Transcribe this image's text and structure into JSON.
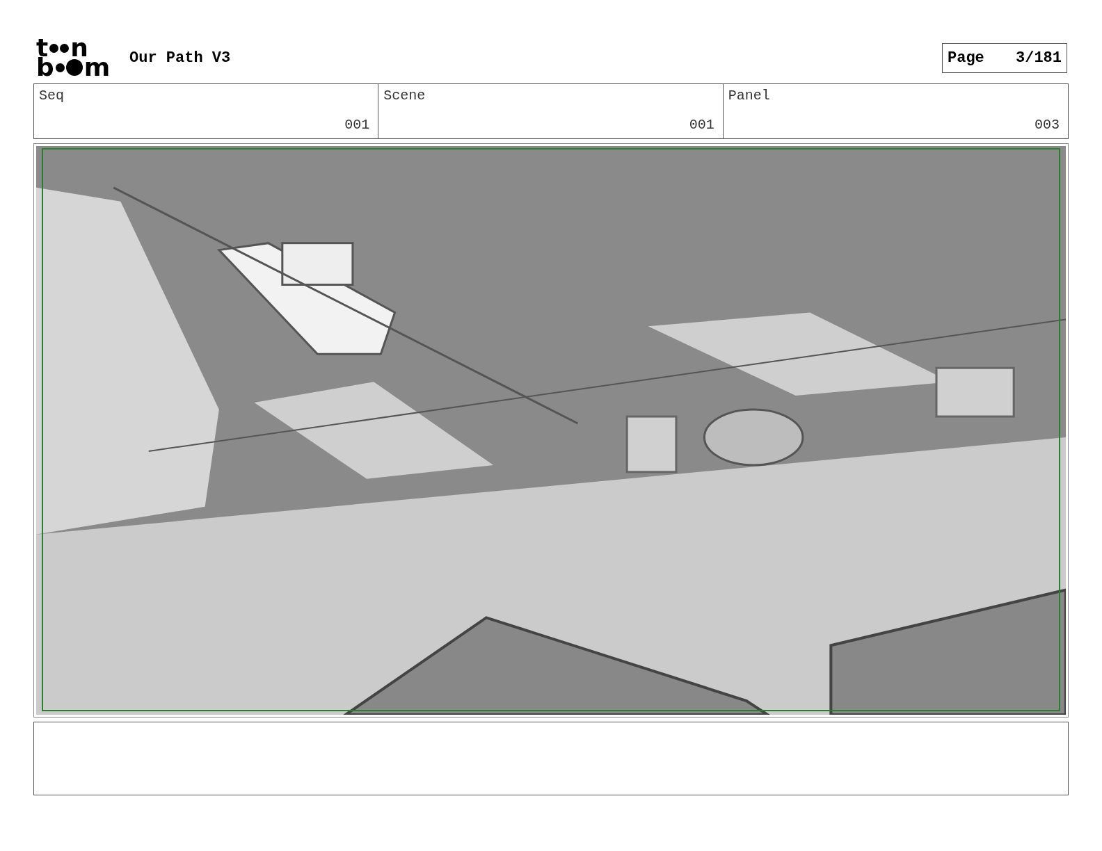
{
  "header": {
    "logo": {
      "rows": [
        [
          "t",
          "n"
        ],
        [
          "b",
          "m"
        ]
      ]
    },
    "title": "Our Path V3",
    "page": {
      "label": "Page",
      "value": "3/181"
    }
  },
  "fields": [
    {
      "label": "Seq",
      "value": "001"
    },
    {
      "label": "Scene",
      "value": "001"
    },
    {
      "label": "Panel",
      "value": "003"
    }
  ]
}
